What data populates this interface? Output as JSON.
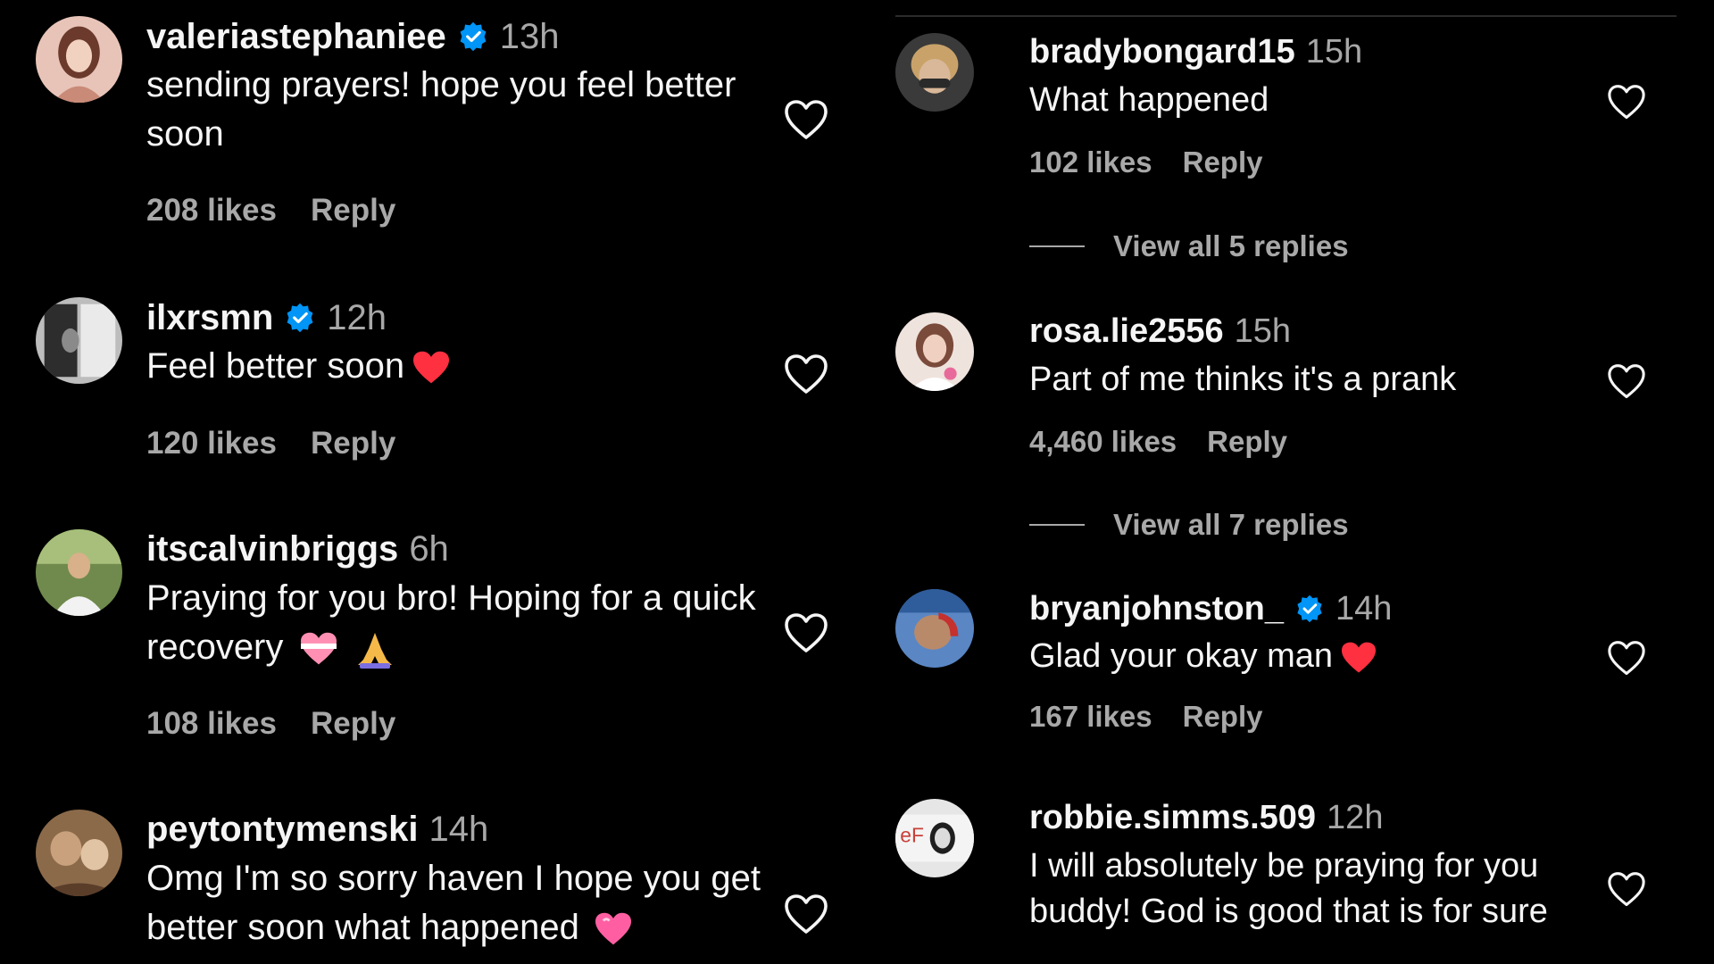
{
  "left_comments": [
    {
      "username": "valeriastephaniee",
      "verified": true,
      "time": "13h",
      "text": "sending prayers! hope you feel better soon",
      "likes": "208 likes",
      "reply": "Reply",
      "avatar_colors": [
        "#c98a78",
        "#6b3a2c"
      ]
    },
    {
      "username": "ilxrsmn",
      "verified": true,
      "time": "12h",
      "text": "Feel better soon",
      "emoji": "red-heart",
      "likes": "120 likes",
      "reply": "Reply",
      "avatar_colors": [
        "#9a9a9a",
        "#2d2d2d"
      ]
    },
    {
      "username": "itscalvinbriggs",
      "verified": false,
      "time": "6h",
      "text": "Praying for you bro! Hoping for a quick recovery",
      "emoji": "heart-and-pray",
      "likes": "108 likes",
      "reply": "Reply",
      "avatar_colors": [
        "#6f8a4c",
        "#d8c6a8"
      ]
    },
    {
      "username": "peytontymenski",
      "verified": false,
      "time": "14h",
      "text": "Omg I'm so sorry haven I hope you get better soon what happened",
      "emoji": "pink-heart",
      "avatar_colors": [
        "#8b6a4a",
        "#c9a27d"
      ]
    }
  ],
  "right_comments": [
    {
      "username": "bradybongard15",
      "verified": false,
      "time": "15h",
      "text": "What happened",
      "likes": "102 likes",
      "reply": "Reply",
      "view_replies": "View all 5 replies",
      "avatar_colors": [
        "#b08a5c",
        "#3a3a3a"
      ]
    },
    {
      "username": "rosa.lie2556",
      "verified": false,
      "time": "15h",
      "text": "Part of me thinks it's a prank",
      "likes": "4,460 likes",
      "reply": "Reply",
      "view_replies": "View all 7 replies",
      "avatar_colors": [
        "#a36b56",
        "#efe3dd"
      ]
    },
    {
      "username": "bryanjohnston_",
      "verified": true,
      "time": "14h",
      "text": "Glad your okay man",
      "emoji": "red-heart",
      "likes": "167 likes",
      "reply": "Reply",
      "avatar_colors": [
        "#2f5c9a",
        "#c4312e"
      ]
    },
    {
      "username": "robbie.simms.509",
      "verified": false,
      "time": "12h",
      "text": "I will absolutely be praying for you buddy! God is good that is for sure",
      "avatar_colors": [
        "#d9d9d9",
        "#c9413a"
      ]
    }
  ],
  "icons": {
    "like": "heart-outline-icon",
    "verified": "verified-badge-icon"
  },
  "colors": {
    "background": "#000000",
    "text_primary": "#f5f5f5",
    "text_secondary": "#a8a8a8",
    "verified_blue": "#0095f6",
    "heart_red": "#ff3040",
    "heart_pink": "#ff5fa2"
  }
}
